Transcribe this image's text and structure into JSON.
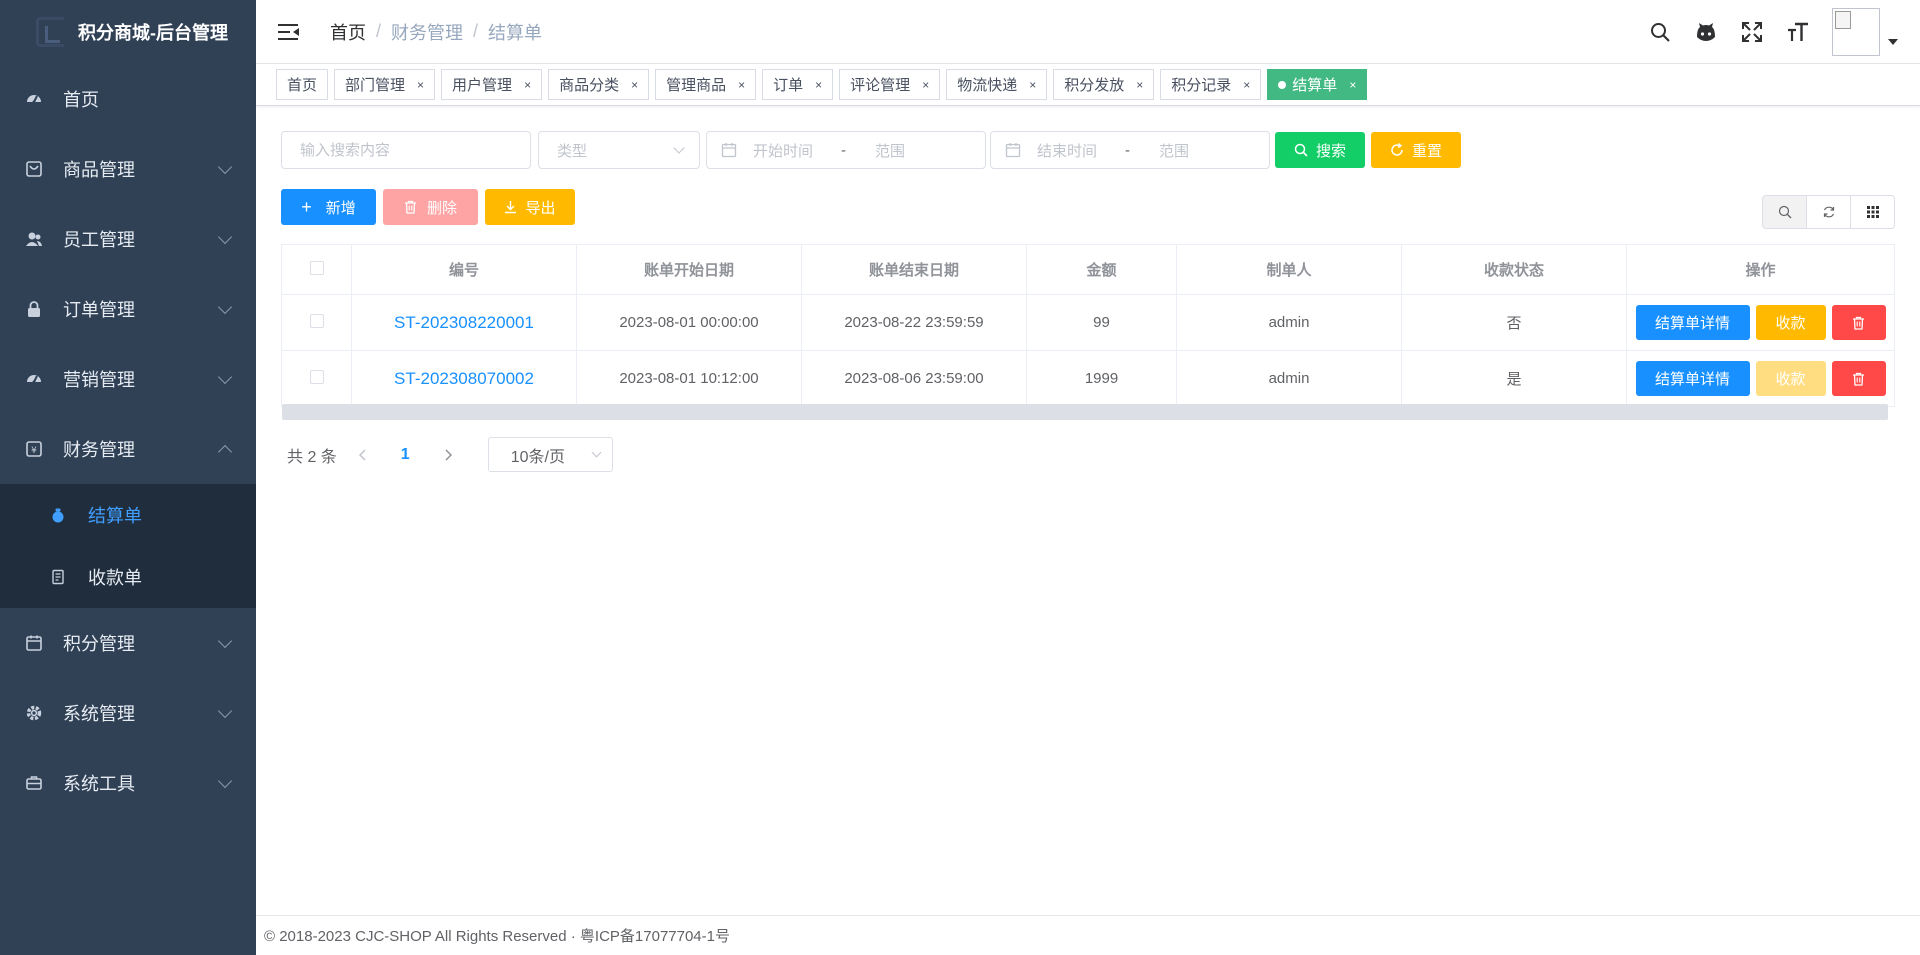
{
  "app": {
    "title": "积分商城-后台管理"
  },
  "sidebar": {
    "items": [
      {
        "label": "首页",
        "icon": "dashboard-icon"
      },
      {
        "label": "商品管理",
        "icon": "goods-icon"
      },
      {
        "label": "员工管理",
        "icon": "peoples-icon"
      },
      {
        "label": "订单管理",
        "icon": "lock-icon"
      },
      {
        "label": "营销管理",
        "icon": "dashboard-icon"
      },
      {
        "label": "财务管理",
        "icon": "money-icon",
        "expanded": true
      },
      {
        "label": "积分管理",
        "icon": "calendar-icon"
      },
      {
        "label": "系统管理",
        "icon": "gear-icon"
      },
      {
        "label": "系统工具",
        "icon": "tool-icon"
      }
    ],
    "finance_sub": [
      {
        "label": "结算单",
        "active": true
      },
      {
        "label": "收款单",
        "active": false
      }
    ]
  },
  "breadcrumb": [
    "首页",
    "财务管理",
    "结算单"
  ],
  "tags": [
    {
      "label": "首页",
      "closable": false
    },
    {
      "label": "部门管理",
      "closable": true
    },
    {
      "label": "用户管理",
      "closable": true
    },
    {
      "label": "商品分类",
      "closable": true
    },
    {
      "label": "管理商品",
      "closable": true
    },
    {
      "label": "订单",
      "closable": true
    },
    {
      "label": "评论管理",
      "closable": true
    },
    {
      "label": "物流快递",
      "closable": true
    },
    {
      "label": "积分发放",
      "closable": true
    },
    {
      "label": "积分记录",
      "closable": true
    },
    {
      "label": "结算单",
      "closable": true,
      "active": true
    }
  ],
  "tag_close": "×",
  "search": {
    "keyword_placeholder": "输入搜索内容",
    "type_placeholder": "类型",
    "start_from": "开始时间",
    "start_to": "范围",
    "end_from": "结束时间",
    "end_to": "范围",
    "range_sep": "-",
    "search_label": "搜索",
    "reset_label": "重置"
  },
  "actions": {
    "add": "新增",
    "delete": "删除",
    "export": "导出"
  },
  "table": {
    "columns": [
      "编号",
      "账单开始日期",
      "账单结束日期",
      "金额",
      "制单人",
      "收款状态",
      "操作"
    ],
    "rows": [
      {
        "code": "ST-202308220001",
        "start": "2023-08-01 00:00:00",
        "end": "2023-08-22 23:59:59",
        "amount": "99",
        "maker": "admin",
        "status": "否",
        "collect_enabled": true
      },
      {
        "code": "ST-202308070002",
        "start": "2023-08-01 10:12:00",
        "end": "2023-08-06 23:59:00",
        "amount": "1999",
        "maker": "admin",
        "status": "是",
        "collect_enabled": false
      }
    ],
    "op_detail": "结算单详情",
    "op_collect": "收款"
  },
  "pagination": {
    "total": "共 2 条",
    "current": "1",
    "page_size": "10条/页"
  },
  "footer": {
    "text": "© 2018-2023 CJC-SHOP All Rights Reserved · 粤ICP备17077704-1号"
  },
  "colors": {
    "sidebar_bg": "#304156",
    "submenu_bg": "#1f2d3d",
    "primary": "#1890ff",
    "success": "#13ce66",
    "warning": "#ffba00",
    "danger": "#ff4949",
    "danger_light": "#ffa4a4",
    "warning_light": "#ffdd80",
    "tag_active": "#42b983"
  }
}
